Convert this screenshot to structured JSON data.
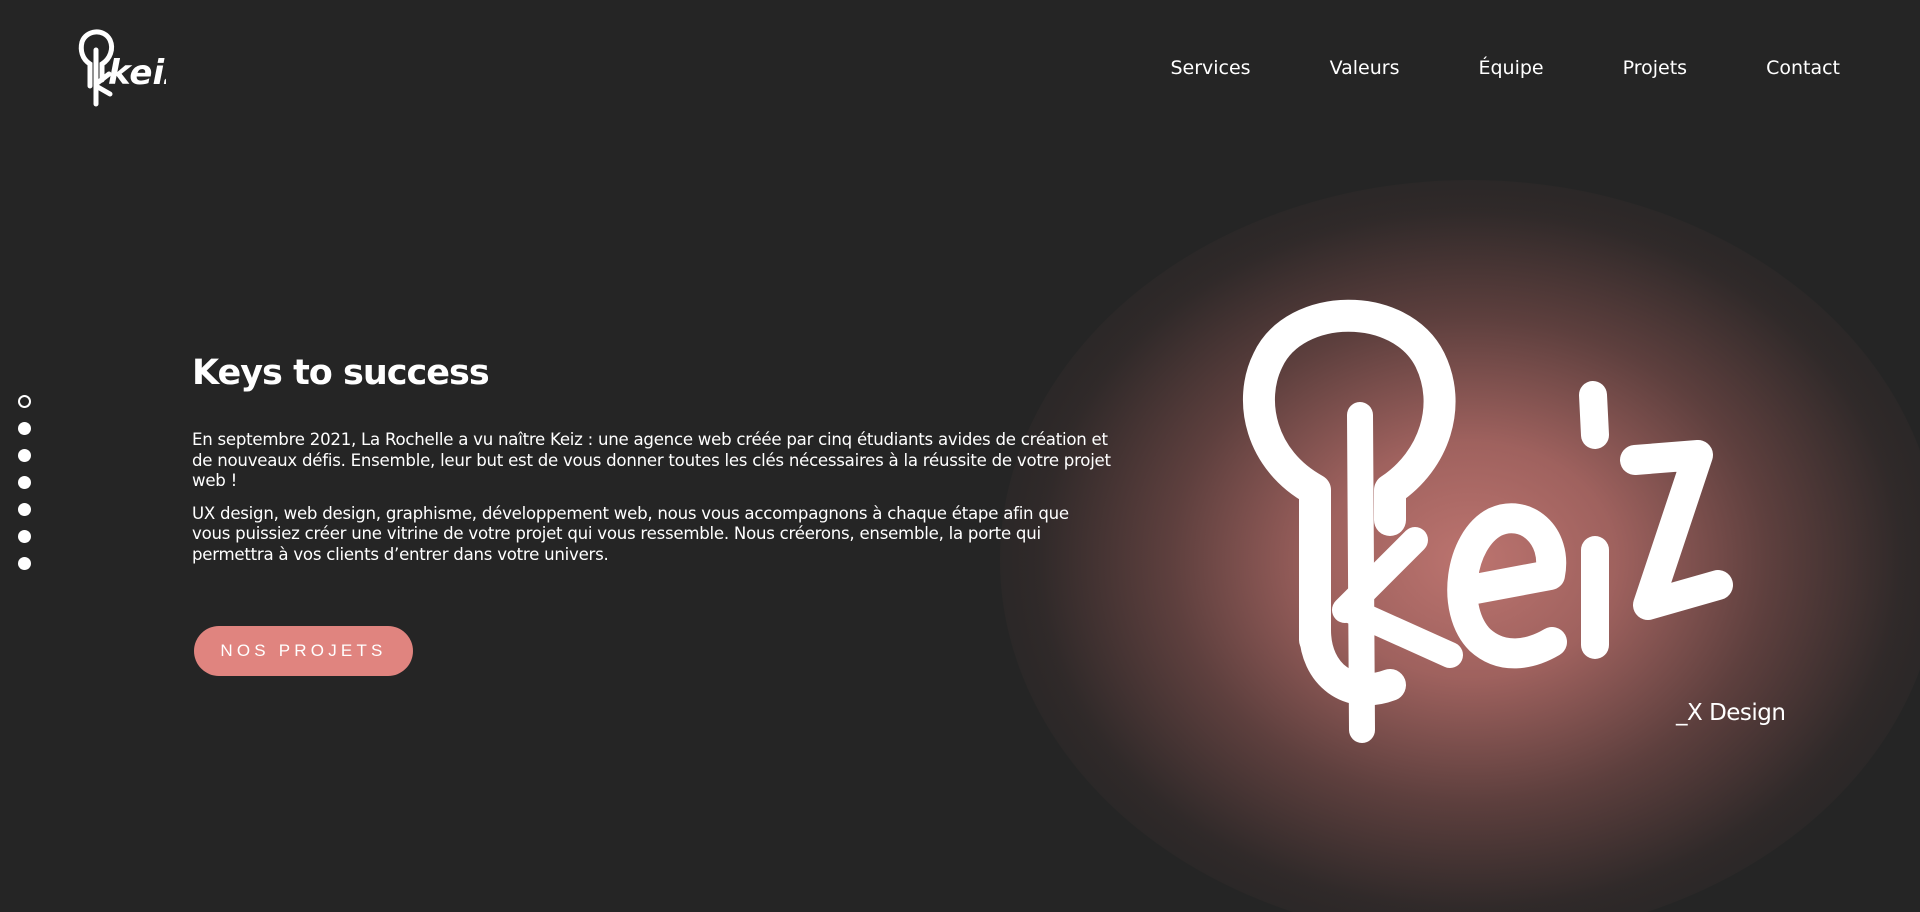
{
  "brand": {
    "logo_text": "keiz",
    "tagline": "_X Design"
  },
  "nav": {
    "items": [
      {
        "label": "Services"
      },
      {
        "label": "Valeurs"
      },
      {
        "label": "Équipe"
      },
      {
        "label": "Projets"
      },
      {
        "label": "Contact"
      }
    ]
  },
  "hero": {
    "title": "Keys to success",
    "paragraphs": [
      "En septembre 2021, La Rochelle a vu naître Keiz : une agence web créée par cinq étudiants avides de création et de nouveaux défis. Ensemble, leur but est de vous donner toutes les clés nécessaires à la réussite de votre projet web !",
      "UX design, web design, graphisme, développement web, nous vous accompagnons à chaque étape afin que vous puissiez créer une vitrine de votre projet qui vous ressemble. Nous créerons, ensemble, la porte qui permettra à vos clients d’entrer dans votre univers."
    ],
    "cta_label": "NOS PROJETS"
  },
  "section_nav": {
    "count": 7,
    "active_index": 0
  },
  "colors": {
    "background": "#252525",
    "accent": "#e0847f",
    "glow": "#c47873",
    "text": "#ffffff"
  }
}
